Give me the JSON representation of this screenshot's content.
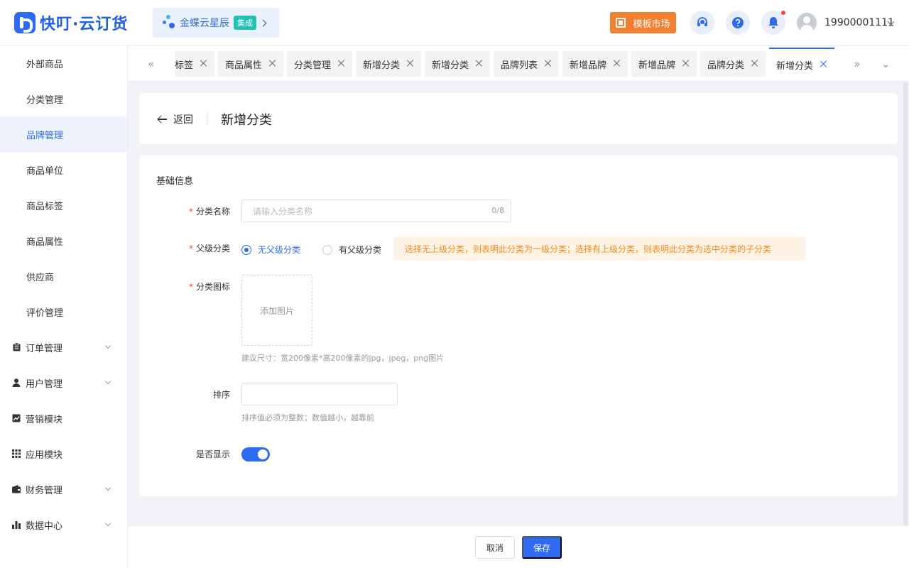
{
  "header": {
    "logo_text": "快叮·云订货",
    "integration_name": "金蝶云星辰",
    "integration_badge": "集成",
    "template_market": "模板市场",
    "user_phone": "19900001111",
    "accent_color": "#2e6bf0",
    "market_color": "#f57f30"
  },
  "sidebar": {
    "sub_items": [
      {
        "label": "外部商品"
      },
      {
        "label": "分类管理"
      },
      {
        "label": "品牌管理",
        "active": true
      },
      {
        "label": "商品单位"
      },
      {
        "label": "商品标签"
      },
      {
        "label": "商品属性"
      },
      {
        "label": "供应商"
      },
      {
        "label": "评价管理"
      }
    ],
    "groups": [
      {
        "label": "订单管理",
        "icon": "clipboard-icon",
        "expandable": true
      },
      {
        "label": "用户管理",
        "icon": "user-icon",
        "expandable": true
      },
      {
        "label": "营销模块",
        "icon": "chart-icon",
        "expandable": false
      },
      {
        "label": "应用模块",
        "icon": "grid-icon",
        "expandable": false
      },
      {
        "label": "财务管理",
        "icon": "wallet-icon",
        "expandable": true
      },
      {
        "label": "数据中心",
        "icon": "bar-chart-icon",
        "expandable": true
      }
    ]
  },
  "tabs": [
    {
      "label": "标签"
    },
    {
      "label": "商品属性"
    },
    {
      "label": "分类管理"
    },
    {
      "label": "新增分类"
    },
    {
      "label": "新增分类"
    },
    {
      "label": "品牌列表"
    },
    {
      "label": "新增品牌"
    },
    {
      "label": "新增品牌"
    },
    {
      "label": "品牌分类"
    },
    {
      "label": "新增分类",
      "active": true
    }
  ],
  "page": {
    "back_label": "返回",
    "title": "新增分类"
  },
  "form": {
    "section_title": "基础信息",
    "name_label": "分类名称",
    "name_placeholder": "请输入分类名称",
    "name_count": "0/8",
    "parent_label": "父级分类",
    "parent_option_none": "无父级分类",
    "parent_option_has": "有父级分类",
    "parent_tip": "选择无上级分类，则表明此分类为一级分类；选择有上级分类，则表明此分类为选中分类的子分类",
    "icon_label": "分类图标",
    "upload_label": "添加图片",
    "icon_hint": "建议尺寸：宽200像素*高200像素的jpg，jpeg，png图片",
    "sort_label": "排序",
    "sort_hint": "排序值必须为整数；数值越小，越靠前",
    "show_label": "是否显示",
    "show_enabled": true
  },
  "footer": {
    "cancel_label": "取消",
    "save_label": "保存"
  }
}
